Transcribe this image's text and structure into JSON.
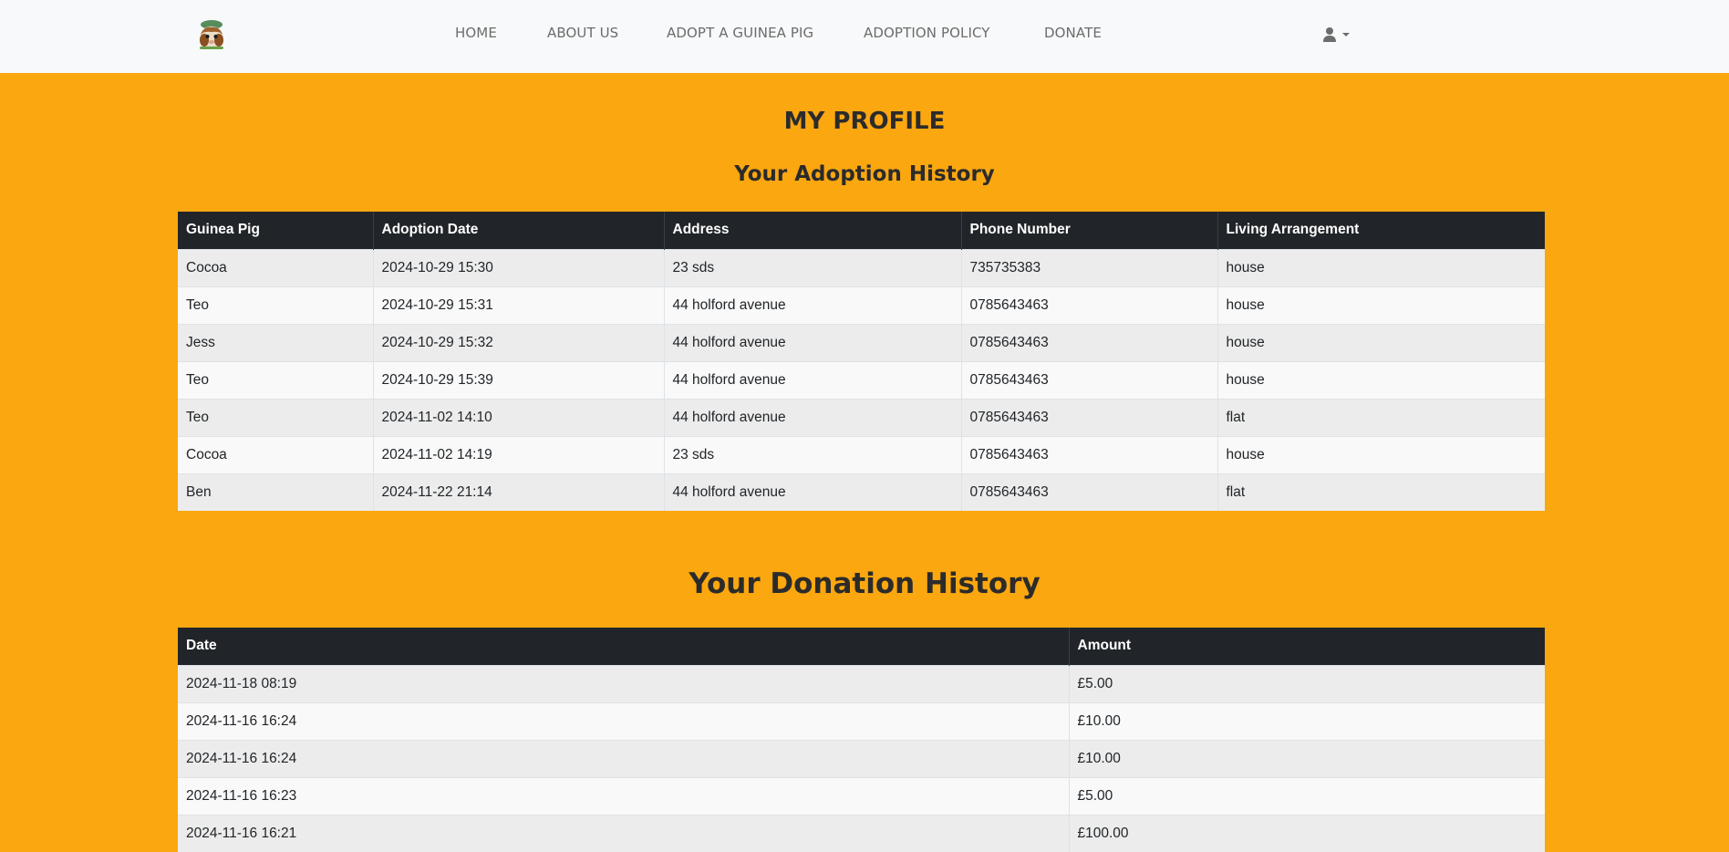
{
  "navbar": {
    "links": [
      "HOME",
      "ABOUT US",
      "ADOPT A GUINEA PIG",
      "ADOPTION POLICY",
      "DONATE"
    ]
  },
  "page": {
    "title": "MY PROFILE"
  },
  "adoption": {
    "title": "Your Adoption History",
    "columns": [
      "Guinea Pig",
      "Adoption Date",
      "Address",
      "Phone Number",
      "Living Arrangement"
    ],
    "rows": [
      [
        "Cocoa",
        "2024-10-29 15:30",
        "23 sds",
        "735735383",
        "house"
      ],
      [
        "Teo",
        "2024-10-29 15:31",
        "44 holford avenue",
        "0785643463",
        "house"
      ],
      [
        "Jess",
        "2024-10-29 15:32",
        "44 holford avenue",
        "0785643463",
        "house"
      ],
      [
        "Teo",
        "2024-10-29 15:39",
        "44 holford avenue",
        "0785643463",
        "house"
      ],
      [
        "Teo",
        "2024-11-02 14:10",
        "44 holford avenue",
        "0785643463",
        "flat"
      ],
      [
        "Cocoa",
        "2024-11-02 14:19",
        "23 sds",
        "0785643463",
        "house"
      ],
      [
        "Ben",
        "2024-11-22 21:14",
        "44 holford avenue",
        "0785643463",
        "flat"
      ]
    ]
  },
  "donation": {
    "title": "Your Donation History",
    "columns": [
      "Date",
      "Amount"
    ],
    "rows": [
      [
        "2024-11-18 08:19",
        "£5.00"
      ],
      [
        "2024-11-16 16:24",
        "£10.00"
      ],
      [
        "2024-11-16 16:24",
        "£10.00"
      ],
      [
        "2024-11-16 16:23",
        "£5.00"
      ],
      [
        "2024-11-16 16:21",
        "£100.00"
      ]
    ]
  },
  "colors": {
    "background": "#fba70f",
    "navbar": "#f8f9fa",
    "table_header": "#212529"
  },
  "icons": {
    "logo": "guinea-pig-logo",
    "user": "user-icon",
    "dropdown": "caret-down-icon"
  }
}
